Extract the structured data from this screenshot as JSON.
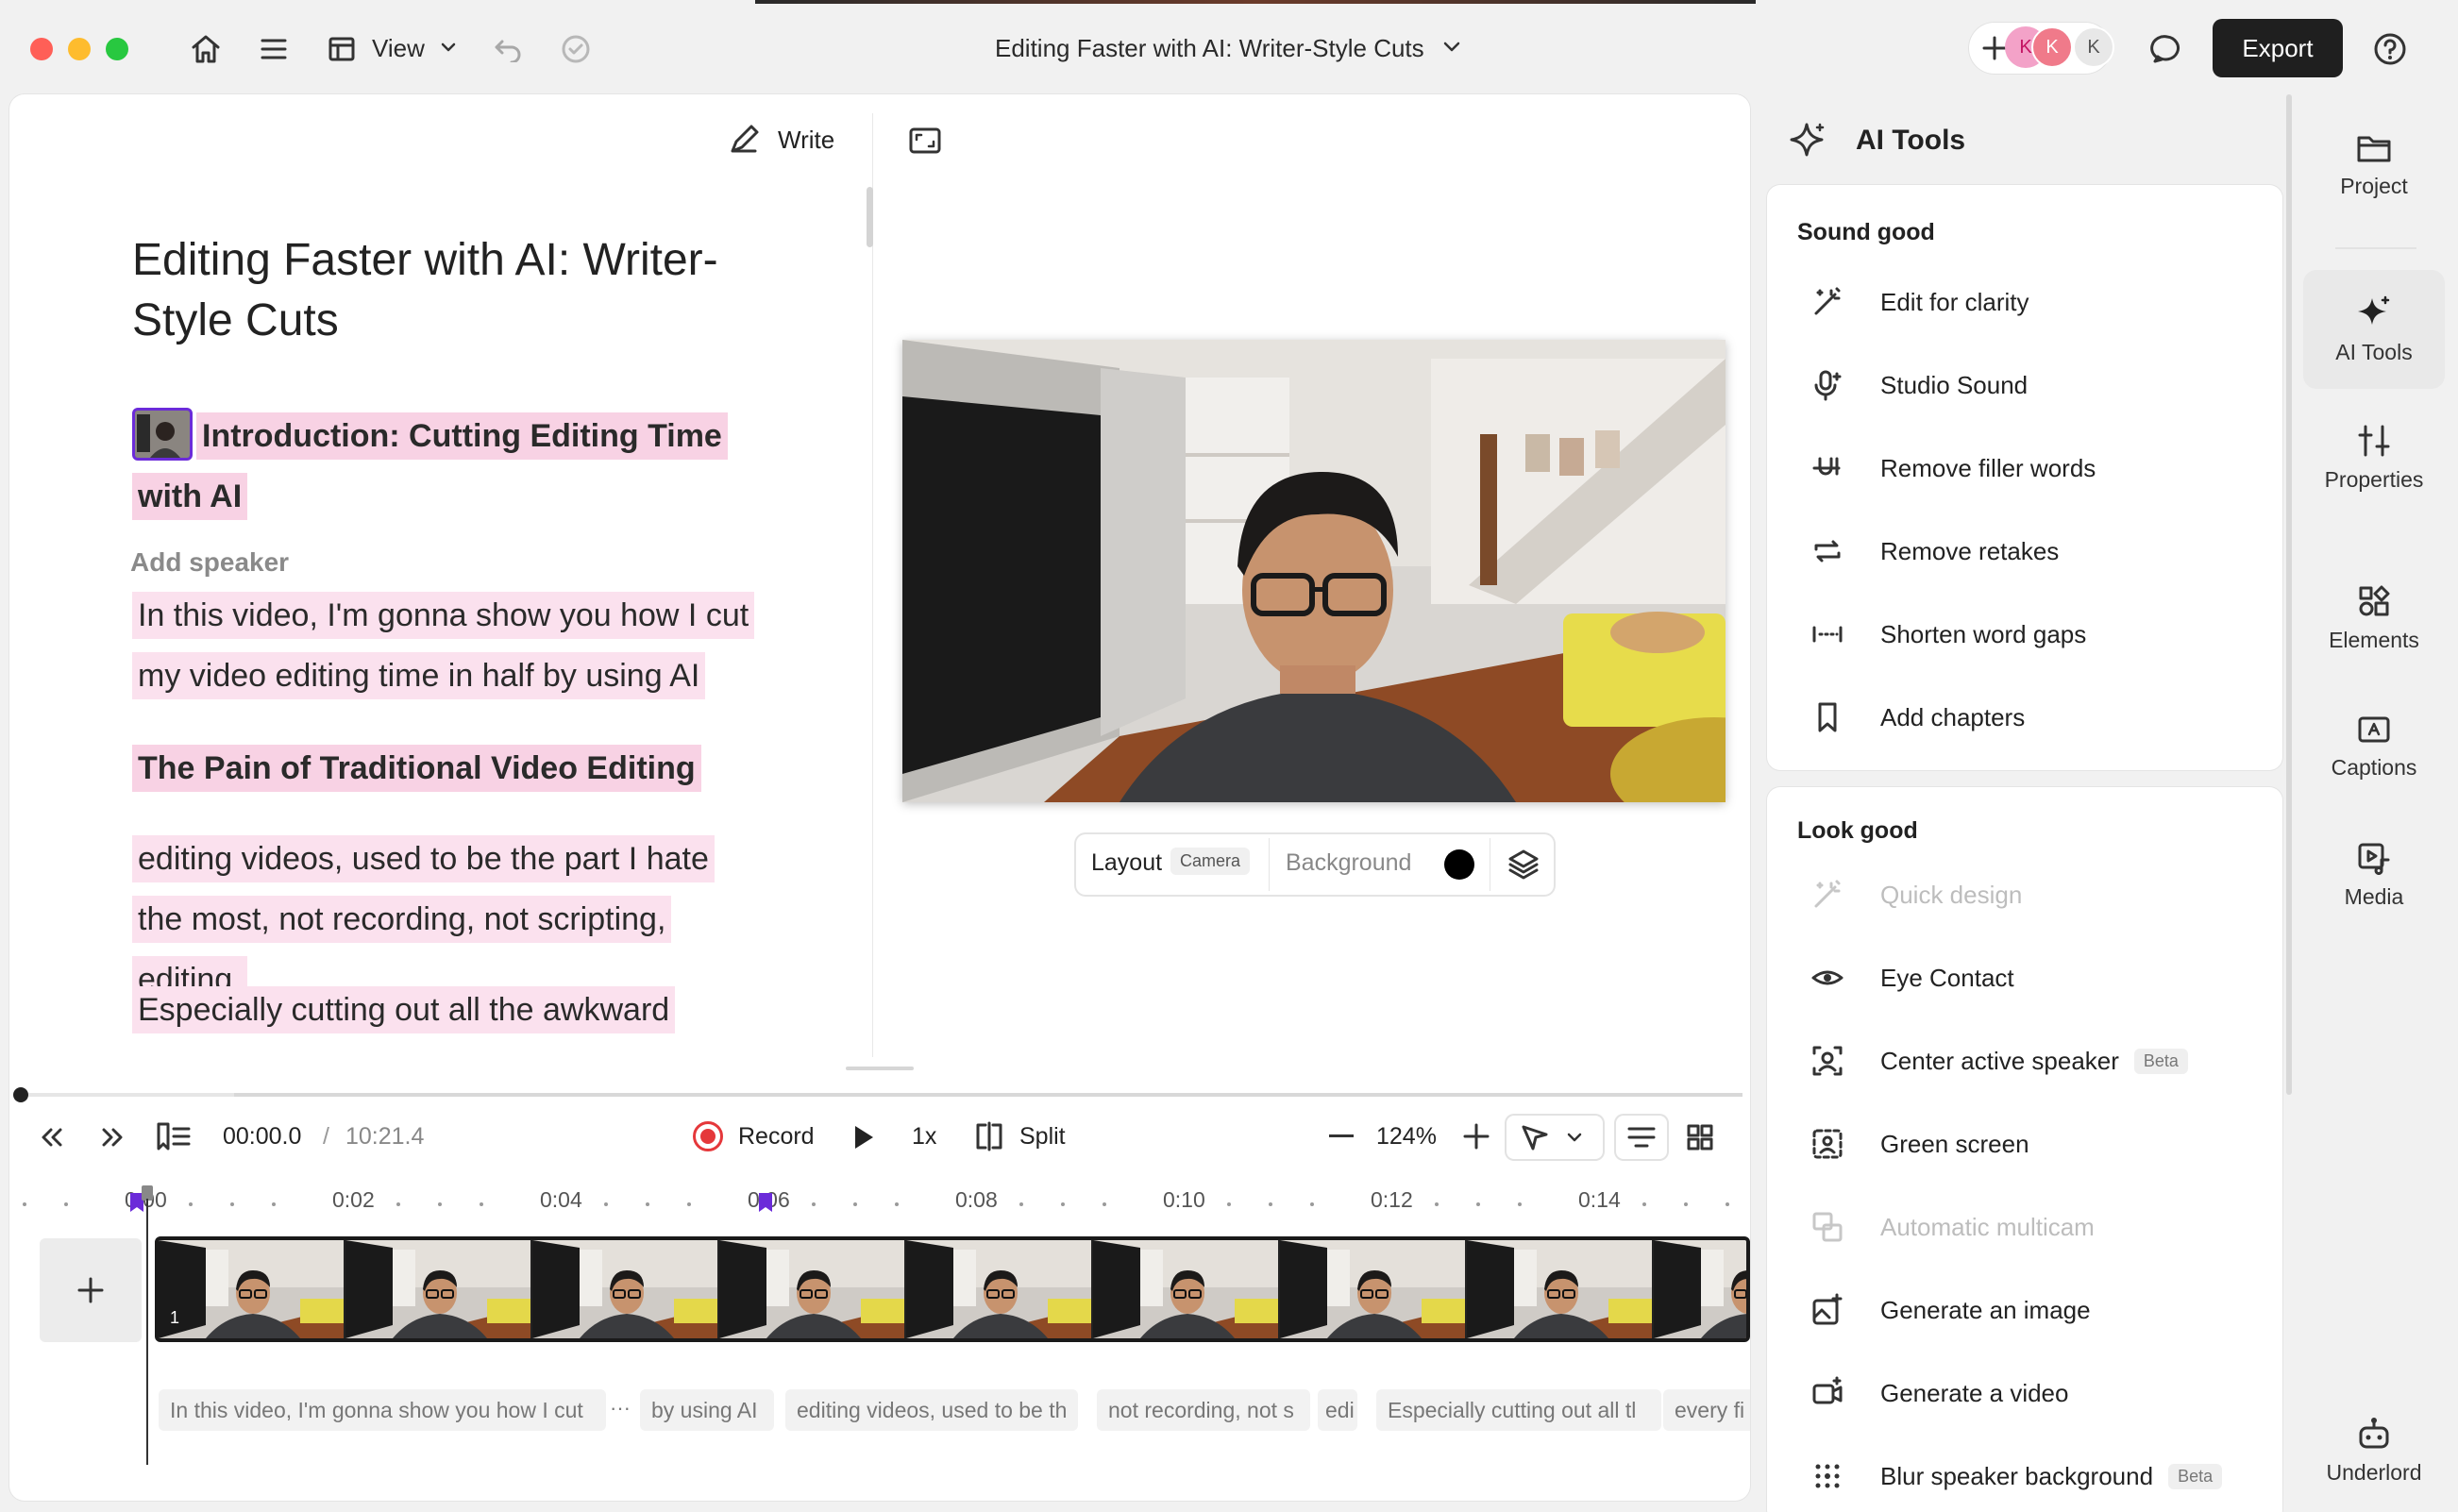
{
  "titlebar": {
    "view_label": "View",
    "document_title": "Editing Faster with AI: Writer-Style Cuts",
    "avatars": [
      "K",
      "K",
      "K"
    ],
    "export_label": "Export"
  },
  "script": {
    "write_label": "Write",
    "title": "Editing Faster with AI: Writer-Style Cuts",
    "intro_heading": "Introduction: Cutting Editing Time with AI",
    "add_speaker": "Add speaker",
    "paragraph1": "In this video, I'm gonna show you how I cut my video editing time in half by using AI",
    "heading2": "The Pain of Traditional Video Editing",
    "paragraph2": "editing videos, used to be the part I hate the most, not recording, not scripting, editing.",
    "paragraph3": "Especially cutting out all the awkward"
  },
  "preview": {
    "layout_label": "Layout",
    "layout_value": "Camera",
    "background_label": "Background",
    "background_color": "#000000"
  },
  "transport": {
    "current_time": "00:00.0",
    "separator": "/",
    "total_time": "10:21.4",
    "record_label": "Record",
    "speed": "1x",
    "split_label": "Split",
    "zoom": "124%"
  },
  "timeline": {
    "ticks": [
      "0:00",
      "0:02",
      "0:04",
      "0:06",
      "0:08",
      "0:10",
      "0:12",
      "0:14"
    ],
    "track_number": "1",
    "segments": [
      "In this video, I'm gonna show you how I cut",
      "···",
      "by using AI",
      "editing videos, used to be th",
      "not recording, not s",
      "edi",
      "Especially cutting out all tl",
      "every fi"
    ]
  },
  "ai_tools": {
    "title": "AI Tools",
    "sound_section": "Sound good",
    "sound_items": [
      {
        "label": "Edit for clarity",
        "icon": "magic-wand-icon",
        "disabled": false
      },
      {
        "label": "Studio Sound",
        "icon": "microphone-sparkle-icon",
        "disabled": false
      },
      {
        "label": "Remove filler words",
        "icon": "strikethrough-u-icon",
        "disabled": false
      },
      {
        "label": "Remove retakes",
        "icon": "repeat-icon",
        "disabled": false
      },
      {
        "label": "Shorten word gaps",
        "icon": "gap-icon",
        "disabled": false
      },
      {
        "label": "Add chapters",
        "icon": "bookmark-icon",
        "disabled": false
      }
    ],
    "look_section": "Look good",
    "look_items": [
      {
        "label": "Quick design",
        "icon": "magic-wand-icon",
        "disabled": true
      },
      {
        "label": "Eye Contact",
        "icon": "eye-icon",
        "disabled": false
      },
      {
        "label": "Center active speaker",
        "icon": "center-speaker-icon",
        "disabled": false,
        "badge": "Beta"
      },
      {
        "label": "Green screen",
        "icon": "green-screen-icon",
        "disabled": false
      },
      {
        "label": "Automatic multicam",
        "icon": "multicam-icon",
        "disabled": true
      },
      {
        "label": "Generate an image",
        "icon": "image-sparkle-icon",
        "disabled": false
      },
      {
        "label": "Generate a video",
        "icon": "video-sparkle-icon",
        "disabled": false
      },
      {
        "label": "Blur speaker background",
        "icon": "blur-icon",
        "disabled": false,
        "badge": "Beta"
      }
    ]
  },
  "nav": {
    "items": [
      {
        "label": "Project",
        "icon": "folder-icon"
      },
      {
        "label": "AI Tools",
        "icon": "sparkle-icon",
        "active": true
      },
      {
        "label": "Properties",
        "icon": "sliders-icon"
      },
      {
        "label": "Elements",
        "icon": "shapes-icon"
      },
      {
        "label": "Captions",
        "icon": "captions-icon"
      },
      {
        "label": "Media",
        "icon": "media-icon"
      },
      {
        "label": "Underlord",
        "icon": "robot-icon"
      }
    ]
  },
  "colors": {
    "accent_purple": "#6b2bd9",
    "highlight_pink": "#fbe1ee",
    "record_red": "#e5383b",
    "export_bg": "#1f1f1f"
  }
}
